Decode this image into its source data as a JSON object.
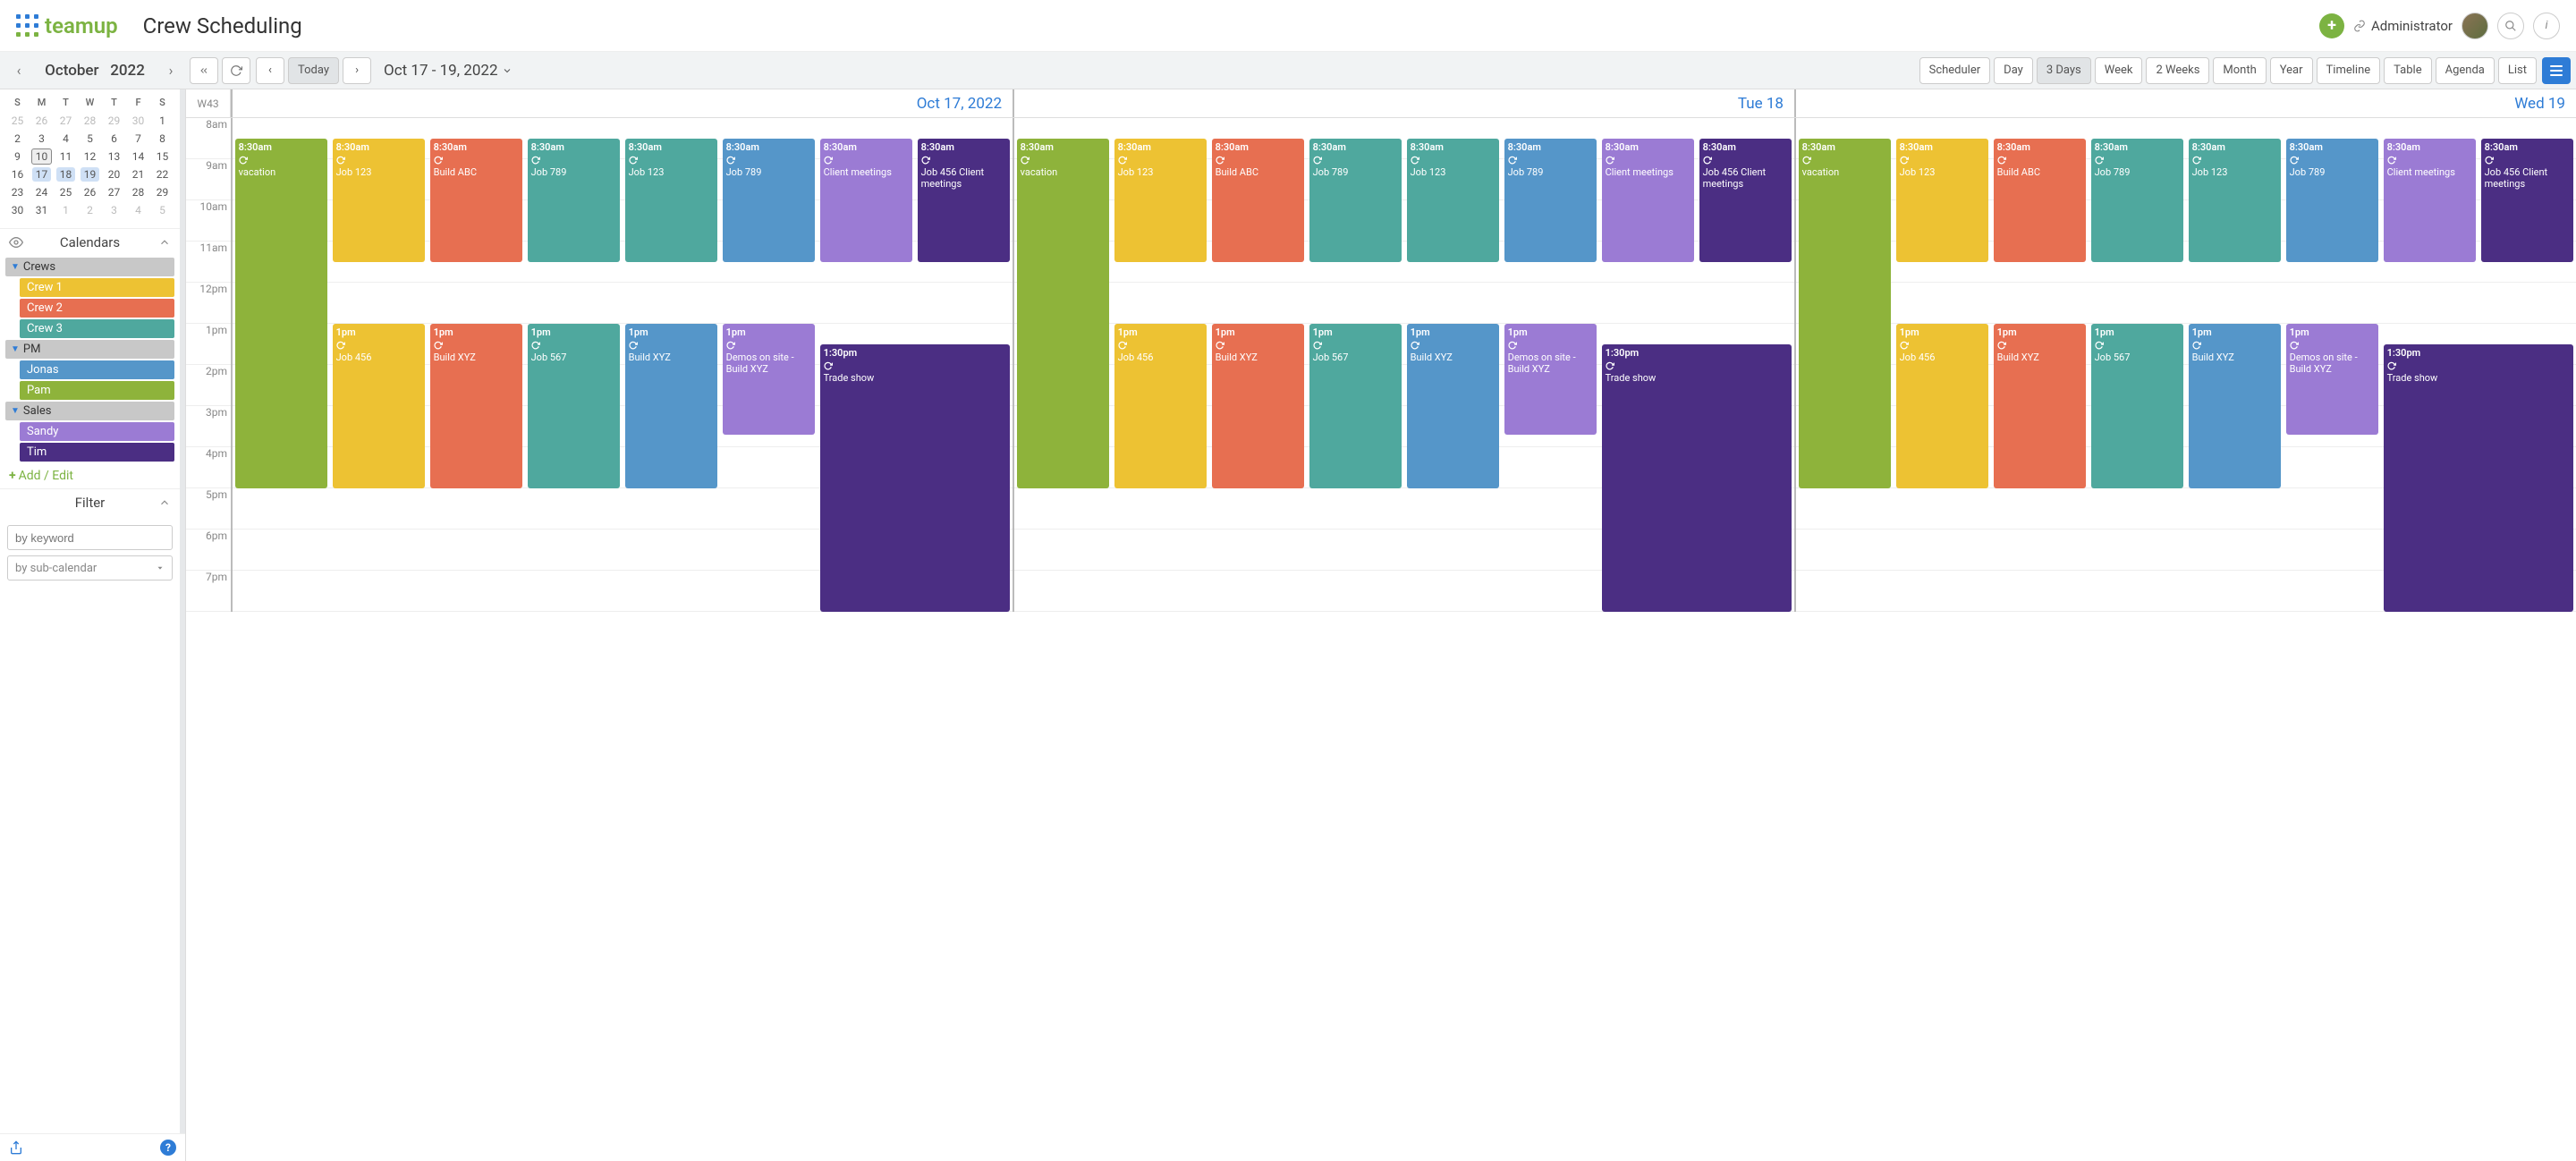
{
  "header": {
    "logo_text": "teamup",
    "app_title": "Crew Scheduling",
    "admin_label": "Administrator"
  },
  "toolbar": {
    "month_label": "October",
    "year_label": "2022",
    "today_label": "Today",
    "date_range": "Oct 17 - 19, 2022",
    "views": [
      "Scheduler",
      "Day",
      "3 Days",
      "Week",
      "2 Weeks",
      "Month",
      "Year",
      "Timeline",
      "Table",
      "Agenda",
      "List"
    ],
    "active_view": "3 Days"
  },
  "mini_cal": {
    "dow": [
      "S",
      "M",
      "T",
      "W",
      "T",
      "F",
      "S"
    ],
    "rows": [
      [
        {
          "d": "25",
          "o": 1
        },
        {
          "d": "26",
          "o": 1
        },
        {
          "d": "27",
          "o": 1
        },
        {
          "d": "28",
          "o": 1
        },
        {
          "d": "29",
          "o": 1
        },
        {
          "d": "30",
          "o": 1
        },
        {
          "d": "1"
        }
      ],
      [
        {
          "d": "2"
        },
        {
          "d": "3"
        },
        {
          "d": "4"
        },
        {
          "d": "5"
        },
        {
          "d": "6"
        },
        {
          "d": "7"
        },
        {
          "d": "8"
        }
      ],
      [
        {
          "d": "9"
        },
        {
          "d": "10",
          "t": 1
        },
        {
          "d": "11"
        },
        {
          "d": "12"
        },
        {
          "d": "13"
        },
        {
          "d": "14"
        },
        {
          "d": "15"
        }
      ],
      [
        {
          "d": "16"
        },
        {
          "d": "17",
          "s": 1
        },
        {
          "d": "18",
          "s": 1
        },
        {
          "d": "19",
          "s": 1
        },
        {
          "d": "20"
        },
        {
          "d": "21"
        },
        {
          "d": "22"
        }
      ],
      [
        {
          "d": "23"
        },
        {
          "d": "24"
        },
        {
          "d": "25"
        },
        {
          "d": "26"
        },
        {
          "d": "27"
        },
        {
          "d": "28"
        },
        {
          "d": "29"
        }
      ],
      [
        {
          "d": "30"
        },
        {
          "d": "31"
        },
        {
          "d": "1",
          "o": 1
        },
        {
          "d": "2",
          "o": 1
        },
        {
          "d": "3",
          "o": 1
        },
        {
          "d": "4",
          "o": 1
        },
        {
          "d": "5",
          "o": 1
        }
      ]
    ]
  },
  "calendars": {
    "title": "Calendars",
    "groups": [
      {
        "name": "Crews",
        "items": [
          {
            "label": "Crew 1",
            "color": "c-yellow"
          },
          {
            "label": "Crew 2",
            "color": "c-red"
          },
          {
            "label": "Crew 3",
            "color": "c-teal"
          }
        ]
      },
      {
        "name": "PM",
        "items": [
          {
            "label": "Jonas",
            "color": "c-blue"
          },
          {
            "label": "Pam",
            "color": "c-olive"
          }
        ]
      },
      {
        "name": "Sales",
        "items": [
          {
            "label": "Sandy",
            "color": "c-purple"
          },
          {
            "label": "Tim",
            "color": "c-dark"
          }
        ]
      }
    ],
    "add_edit": "Add / Edit"
  },
  "filter": {
    "title": "Filter",
    "keyword_placeholder": "by keyword",
    "subcal_placeholder": "by sub-calendar"
  },
  "grid": {
    "week_label": "W43",
    "hours": [
      "8am",
      "9am",
      "10am",
      "11am",
      "12pm",
      "1pm",
      "2pm",
      "3pm",
      "4pm",
      "5pm",
      "6pm",
      "7pm"
    ],
    "days": [
      {
        "label": "Oct 17, 2022"
      },
      {
        "label": "Tue 18"
      },
      {
        "label": "Wed 19"
      }
    ],
    "day_events_template": {
      "morning": [
        {
          "time": "8:30am",
          "title": "vacation",
          "color": "c-olive",
          "tall": true
        },
        {
          "time": "8:30am",
          "title": "Job 123",
          "color": "c-yellow"
        },
        {
          "time": "8:30am",
          "title": "Build ABC",
          "color": "c-red"
        },
        {
          "time": "8:30am",
          "title": "Job 789",
          "color": "c-teal"
        },
        {
          "time": "8:30am",
          "title": "Job 123",
          "color": "c-teal"
        },
        {
          "time": "8:30am",
          "title": "Job 789",
          "color": "c-blue"
        },
        {
          "time": "8:30am",
          "title": "Client meetings",
          "color": "c-purple"
        },
        {
          "time": "8:30am",
          "title": "Job 456 Client meetings",
          "color": "c-dark"
        }
      ],
      "afternoon": [
        {
          "time": "1pm",
          "title": "Job 456",
          "color": "c-yellow"
        },
        {
          "time": "1pm",
          "title": "Build XYZ",
          "color": "c-red"
        },
        {
          "time": "1pm",
          "title": "Job 567",
          "color": "c-teal"
        },
        {
          "time": "1pm",
          "title": "Build XYZ",
          "color": "c-blue"
        },
        {
          "time": "1pm",
          "title": "Demos on site - Build XYZ",
          "color": "c-purple",
          "med": true
        }
      ],
      "trade": {
        "time": "1:30pm",
        "title": "Trade show",
        "color": "c-dark"
      }
    }
  }
}
